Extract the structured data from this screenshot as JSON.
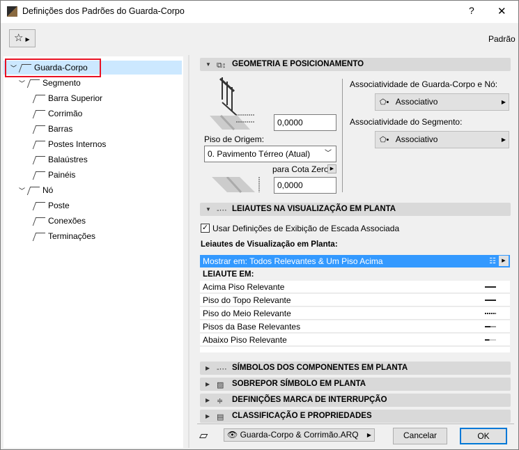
{
  "window": {
    "title": "Definições dos Padrões do Guarda-Corpo",
    "help": "?",
    "close": "✕"
  },
  "toolbar": {
    "preset": "Padrão"
  },
  "tree": [
    {
      "label": "Guarda-Corpo",
      "level": 0,
      "expanded": true,
      "selected": true
    },
    {
      "label": "Segmento",
      "level": 1,
      "expanded": true
    },
    {
      "label": "Barra Superior",
      "level": 2
    },
    {
      "label": "Corrimão",
      "level": 2
    },
    {
      "label": "Barras",
      "level": 2
    },
    {
      "label": "Postes Internos",
      "level": 2
    },
    {
      "label": "Balaústres",
      "level": 2
    },
    {
      "label": "Painéis",
      "level": 2
    },
    {
      "label": "Nó",
      "level": 1,
      "expanded": true
    },
    {
      "label": "Poste",
      "level": 2
    },
    {
      "label": "Conexões",
      "level": 2
    },
    {
      "label": "Terminações",
      "level": 2
    }
  ],
  "geometry": {
    "title": "GEOMETRIA E POSICIONAMENTO",
    "height_value": "0,0000",
    "origin_label": "Piso de Origem:",
    "origin_value": "0. Pavimento Térreo (Atual)",
    "zero_label": "para Cota Zero",
    "zero_value": "0,0000",
    "assoc_node_label": "Associatividade de Guarda-Corpo e Nó:",
    "assoc_node_value": "Associativo",
    "assoc_seg_label": "Associatividade do Segmento:",
    "assoc_seg_value": "Associativo"
  },
  "layouts": {
    "title": "LEIAUTES NA VISUALIZAÇÃO EM PLANTA",
    "checkbox_label": "Usar Definições de Exibição de Escada Associada",
    "checked": true,
    "list_label": "Leiautes de Visualização em Planta:",
    "show_on": "Mostrar em: Todos Relevantes & Um Piso Acima",
    "layout_on": "LEIAUTE EM:",
    "rows": [
      {
        "label": "Acima Piso Relevante",
        "symbol": "solid"
      },
      {
        "label": "Piso do Topo Relevante",
        "symbol": "solid"
      },
      {
        "label": "Piso do Meio Relevante",
        "symbol": "break"
      },
      {
        "label": "Pisos da Base Relevantes",
        "symbol": "break-dashed"
      },
      {
        "label": "Abaixo Piso Relevante",
        "symbol": "break-faded"
      }
    ]
  },
  "sections": [
    {
      "title": "SÍMBOLOS DOS COMPONENTES EM PLANTA",
      "icon": "-⋯"
    },
    {
      "title": "SOBREPOR SÍMBOLO EM PLANTA",
      "icon": "▨"
    },
    {
      "title": "DEFINIÇÕES MARCA DE INTERRUPÇÃO",
      "icon": "≑"
    },
    {
      "title": "CLASSIFICAÇÃO E PROPRIEDADES",
      "icon": "▤"
    }
  ],
  "footer": {
    "layer": "Guarda-Corpo & Corrimão.ARQ",
    "cancel": "Cancelar",
    "ok": "OK"
  },
  "colors": {
    "selection": "#3399ff",
    "tree_selected": "#cce8ff",
    "highlight_border": "#e81123",
    "ok_border": "#0078d7"
  }
}
